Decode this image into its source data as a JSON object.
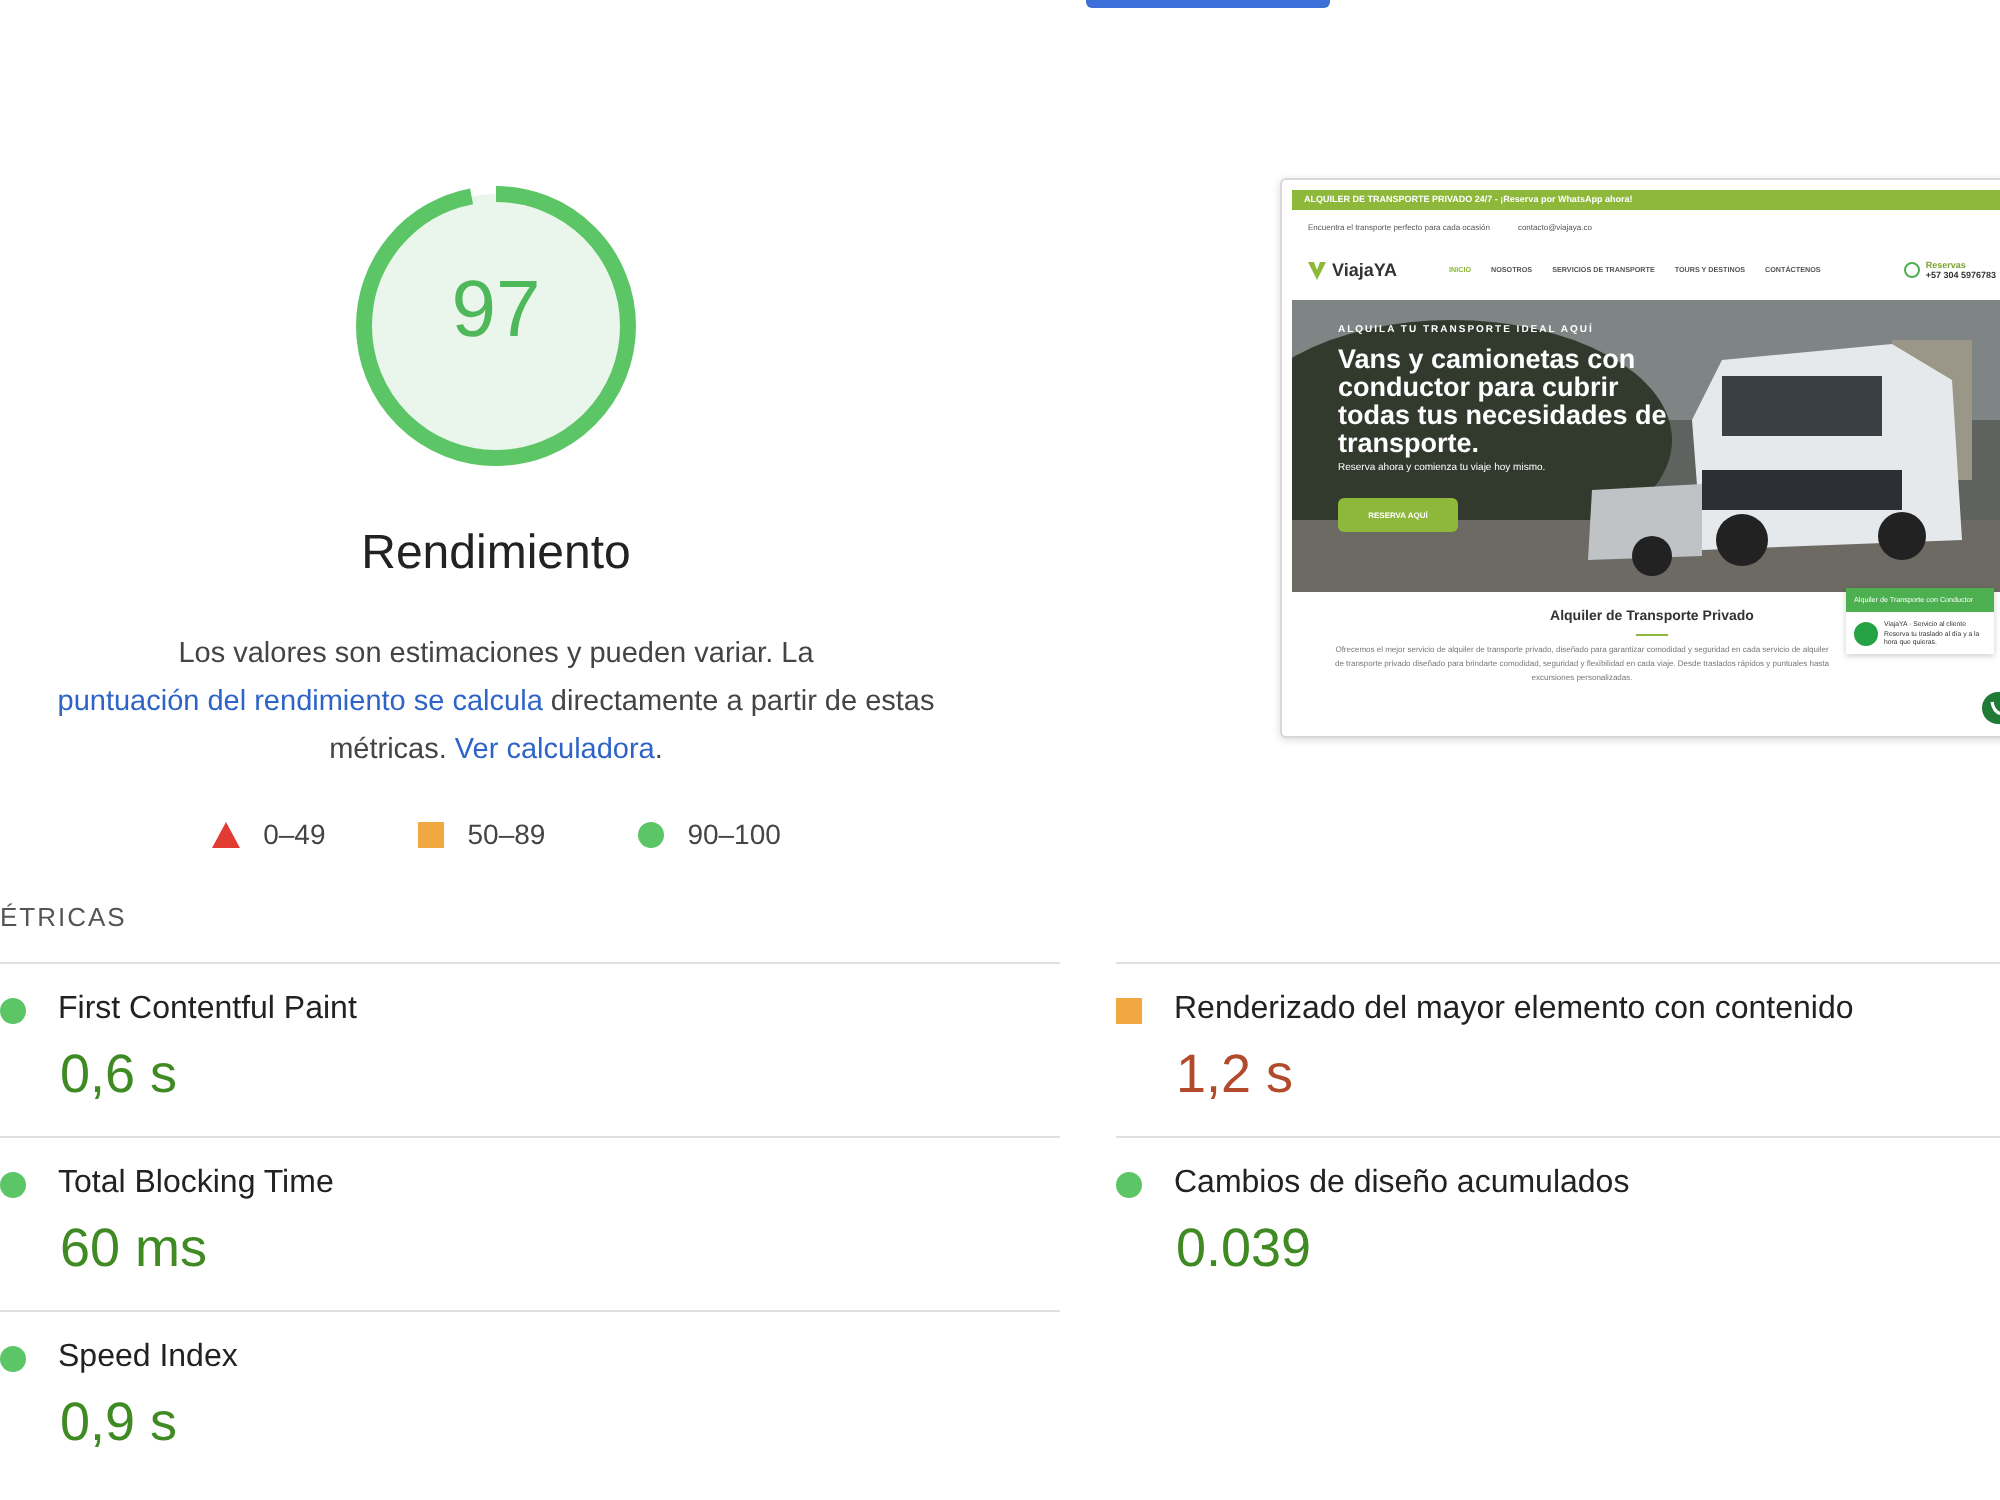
{
  "score": {
    "value": "97",
    "level": 0.97,
    "title": "Rendimiento"
  },
  "description": {
    "before": "Los valores son estimaciones y pueden variar. La ",
    "link1": "puntuación del rendimiento se calcula",
    "middle": " directamente a partir de estas métricas. ",
    "link2": "Ver calculadora",
    "after": "."
  },
  "legend": [
    {
      "kind": "fail",
      "label": "0–49"
    },
    {
      "kind": "average",
      "label": "50–89"
    },
    {
      "kind": "pass",
      "label": "90–100"
    }
  ],
  "preview": {
    "topbar": "ALQUILER DE TRANSPORTE PRIVADO 24/7 - ¡Reserva por WhatsApp ahora!",
    "tagline": "Encuentra el transporte perfecto para cada ocasión",
    "email": "contacto@viajaya.co",
    "logo": "ViajaYA",
    "nav": [
      {
        "label": "INICIO",
        "selected": true
      },
      {
        "label": "NOSOTROS",
        "selected": false
      },
      {
        "label": "SERVICIOS DE TRANSPORTE",
        "selected": false
      },
      {
        "label": "TOURS Y DESTINOS",
        "selected": false
      },
      {
        "label": "CONTÁCTENOS",
        "selected": false
      }
    ],
    "phone_label": "Reservas",
    "phone": "+57 304 5976783",
    "hero_eyebrow": "ALQUILA TU TRANSPORTE IDEAL AQUÍ",
    "hero_title": "Vans y camionetas con conductor para cubrir todas tus necesidades de transporte.",
    "hero_sub": "Reserva ahora y comienza tu viaje hoy mismo.",
    "hero_button": "RESERVA AQUÍ",
    "section_title": "Alquiler de Transporte Privado",
    "section_text": "Ofrecemos el mejor servicio de alquiler de transporte privado, diseñado para garantizar comodidad y seguridad en cada servicio de alquiler de transporte privado diseñado para brindarte comodidad, seguridad y flexibilidad en cada viaje. Desde traslados rápidos y puntuales hasta excursiones personalizadas.",
    "chat_title": "Alquiler de Transporte con Conductor",
    "chat_from": "ViajaYA · Servicio al cliente",
    "chat_message": "Reserva tu traslado al día y a la hora que quieras."
  },
  "metrics_heading": "ÉTRICAS",
  "metrics": [
    {
      "label": "First Contentful Paint",
      "value": "0,6 s",
      "kind": "pass"
    },
    {
      "label": "Renderizado del mayor elemento con contenido",
      "value": "1,2 s",
      "kind": "average"
    },
    {
      "label": "Total Blocking Time",
      "value": "60 ms",
      "kind": "pass"
    },
    {
      "label": "Cambios de diseño acumulados",
      "value": "0.039",
      "kind": "pass"
    },
    {
      "label": "Speed Index",
      "value": "0,9 s",
      "kind": "pass"
    }
  ]
}
